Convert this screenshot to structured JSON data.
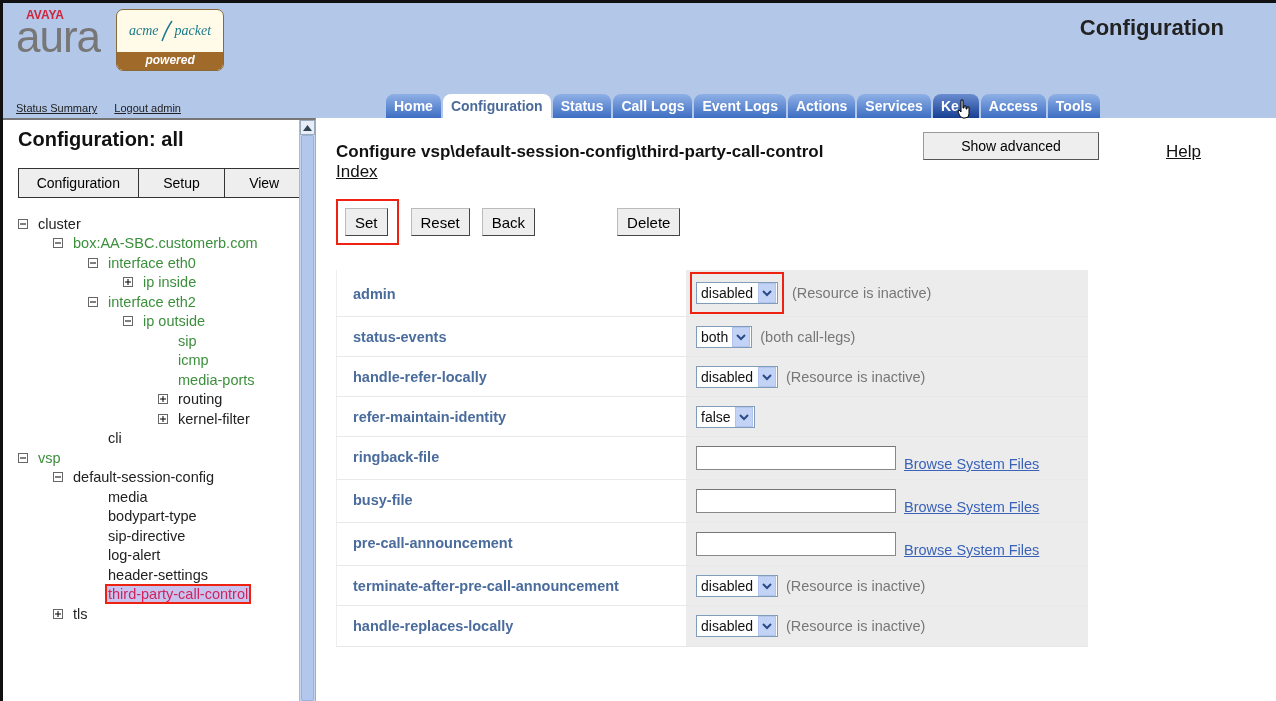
{
  "logo": {
    "brand": "AVAYA",
    "product": "aura",
    "badge_name": "acme",
    "badge_name_2": "packet",
    "badge_caption": "powered"
  },
  "header": {
    "title": "Configuration",
    "links": [
      "Status Summary",
      "Logout admin"
    ]
  },
  "tabs": [
    {
      "label": "Home",
      "selected": false
    },
    {
      "label": "Configuration",
      "selected": true
    },
    {
      "label": "Status",
      "selected": false
    },
    {
      "label": "Call Logs",
      "selected": false
    },
    {
      "label": "Event Logs",
      "selected": false
    },
    {
      "label": "Actions",
      "selected": false
    },
    {
      "label": "Services",
      "selected": false
    },
    {
      "label": "Ke",
      "selected": false,
      "hovered": true
    },
    {
      "label": "Access",
      "selected": false
    },
    {
      "label": "Tools",
      "selected": false
    }
  ],
  "sidebar": {
    "title": "Configuration: all",
    "view_buttons": [
      "Configuration",
      "Setup",
      "View"
    ],
    "tree": [
      {
        "label": "cluster",
        "color": "#222222",
        "selected": false,
        "highlighted": false,
        "expanded": true,
        "children": [
          {
            "label": "box:AA-SBC.customerb.com",
            "color": "#3c8f3c",
            "selected": false,
            "highlighted": false,
            "expanded": true,
            "children": [
              {
                "label": "interface eth0",
                "color": "#3c8f3c",
                "selected": false,
                "highlighted": false,
                "expanded": true,
                "children": [
                  {
                    "label": "ip inside",
                    "color": "#3c8f3c",
                    "selected": false,
                    "highlighted": false,
                    "expanded": false
                  }
                ]
              },
              {
                "label": "interface eth2",
                "color": "#3c8f3c",
                "selected": false,
                "highlighted": false,
                "expanded": true,
                "children": [
                  {
                    "label": "ip outside",
                    "color": "#3c8f3c",
                    "selected": false,
                    "highlighted": false,
                    "expanded": true,
                    "children": [
                      {
                        "label": "sip",
                        "color": "#3c8f3c",
                        "selected": false,
                        "highlighted": false
                      },
                      {
                        "label": "icmp",
                        "color": "#3c8f3c",
                        "selected": false,
                        "highlighted": false
                      },
                      {
                        "label": "media-ports",
                        "color": "#3c8f3c",
                        "selected": false,
                        "highlighted": false
                      },
                      {
                        "label": "routing",
                        "color": "#222222",
                        "selected": false,
                        "highlighted": false,
                        "expanded": false
                      },
                      {
                        "label": "kernel-filter",
                        "color": "#222222",
                        "selected": false,
                        "highlighted": false,
                        "expanded": false
                      }
                    ]
                  }
                ]
              },
              {
                "label": "cli",
                "color": "#222222",
                "selected": false,
                "highlighted": false
              }
            ]
          }
        ]
      },
      {
        "label": "vsp",
        "color": "#3c8f3c",
        "selected": false,
        "highlighted": false,
        "expanded": true,
        "children": [
          {
            "label": "default-session-config",
            "color": "#222222",
            "selected": false,
            "highlighted": false,
            "expanded": true,
            "children": [
              {
                "label": "media",
                "color": "#222222",
                "selected": false,
                "highlighted": false
              },
              {
                "label": "bodypart-type",
                "color": "#222222",
                "selected": false,
                "highlighted": false
              },
              {
                "label": "sip-directive",
                "color": "#222222",
                "selected": false,
                "highlighted": false
              },
              {
                "label": "log-alert",
                "color": "#222222",
                "selected": false,
                "highlighted": false
              },
              {
                "label": "header-settings",
                "color": "#222222",
                "selected": false,
                "highlighted": false
              },
              {
                "label": "third-party-call-control",
                "color": "#d0245a",
                "selected": true,
                "highlighted": true
              }
            ]
          },
          {
            "label": "tls",
            "color": "#222222",
            "selected": false,
            "highlighted": false,
            "expanded": false
          }
        ]
      }
    ]
  },
  "main": {
    "title": "Configure vsp\\default-session-config\\third-party-call-control",
    "show_advanced": "Show advanced",
    "help": "Help",
    "index": "Index",
    "actions": [
      {
        "label": "Set",
        "highlighted": true
      },
      {
        "label": "Reset",
        "highlighted": false
      },
      {
        "label": "Back",
        "highlighted": false
      },
      {
        "label": "Delete",
        "highlighted": false
      }
    ],
    "fields": [
      {
        "name": "admin",
        "kind": "select",
        "value": "disabled",
        "note": "(Resource is inactive)",
        "highlighted": true
      },
      {
        "name": "status-events",
        "kind": "select",
        "value": "both",
        "note": "(both call-legs)",
        "highlighted": false
      },
      {
        "name": "handle-refer-locally",
        "kind": "select",
        "value": "disabled",
        "note": "(Resource is inactive)",
        "highlighted": false
      },
      {
        "name": "refer-maintain-identity",
        "kind": "select",
        "value": "false",
        "highlighted": false
      },
      {
        "name": "ringback-file",
        "kind": "file",
        "link": "Browse System Files",
        "highlighted": false
      },
      {
        "name": "busy-file",
        "kind": "file",
        "link": "Browse System Files",
        "highlighted": false
      },
      {
        "name": "pre-call-announcement",
        "kind": "file",
        "link": "Browse System Files",
        "highlighted": false
      },
      {
        "name": "terminate-after-pre-call-announcement",
        "kind": "select",
        "value": "disabled",
        "note": "(Resource is inactive)",
        "highlighted": false
      },
      {
        "name": "handle-replaces-locally",
        "kind": "select",
        "value": "disabled",
        "note": "(Resource is inactive)",
        "highlighted": false
      }
    ]
  }
}
